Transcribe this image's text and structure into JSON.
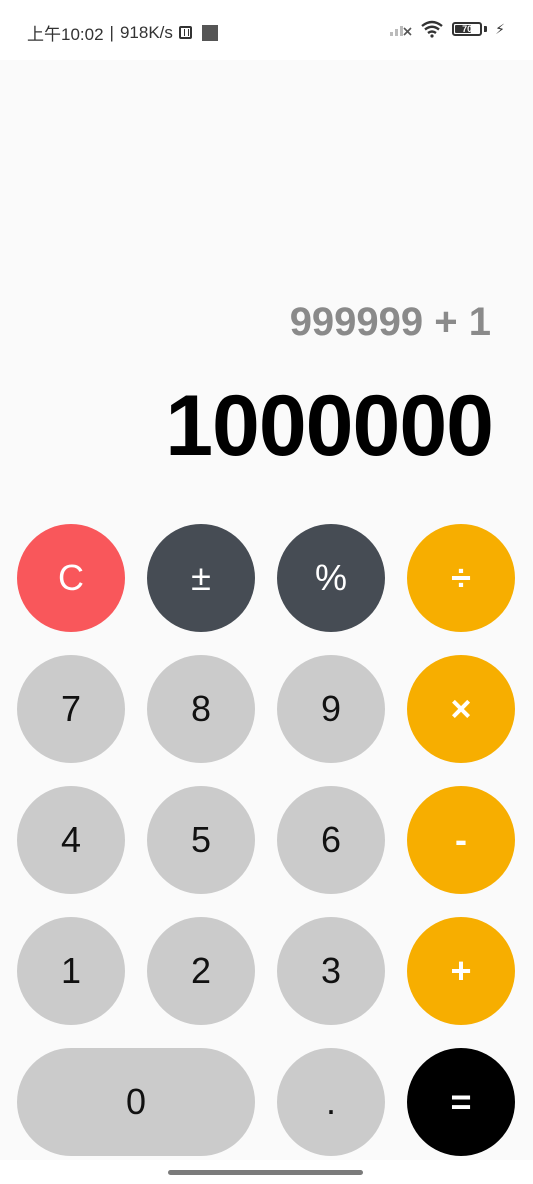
{
  "status_bar": {
    "time": "上午10:02",
    "separator": "|",
    "network_speed": "918K/s",
    "battery_level": "70",
    "icons": [
      "nfc-icon",
      "square-icon",
      "signal-icon",
      "wifi-icon",
      "battery-icon",
      "charging-bolt-icon"
    ]
  },
  "display": {
    "expression": "999999 + 1",
    "result": "1000000"
  },
  "keys": {
    "clear": "C",
    "sign": "±",
    "percent": "%",
    "divide": "÷",
    "seven": "7",
    "eight": "8",
    "nine": "9",
    "multiply": "×",
    "four": "4",
    "five": "5",
    "six": "6",
    "subtract": "-",
    "one": "1",
    "two": "2",
    "three": "3",
    "add": "+",
    "zero": "0",
    "decimal": ".",
    "equals": "="
  },
  "colors": {
    "clear": "#f9575b",
    "function": "#464c54",
    "operator": "#f7ae00",
    "number": "#cbcbcb",
    "equals": "#000000"
  }
}
